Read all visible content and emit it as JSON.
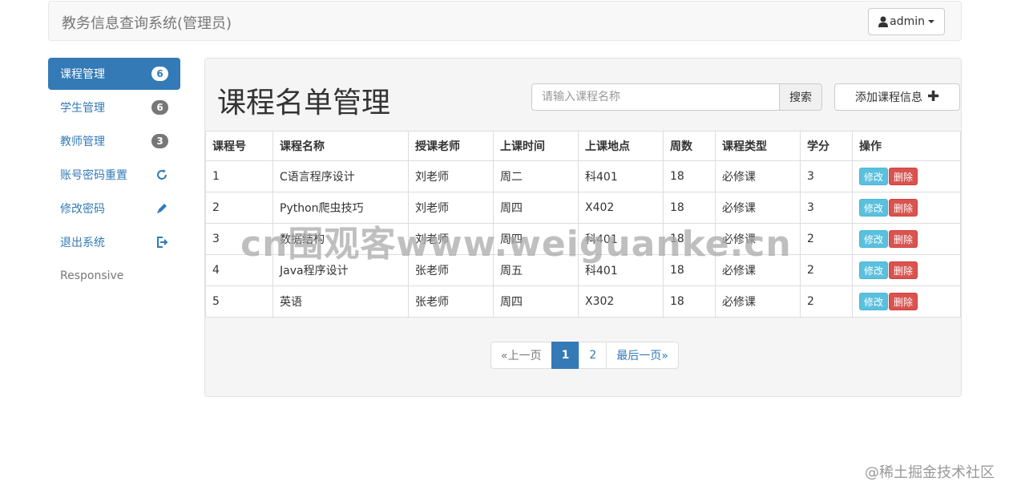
{
  "header": {
    "brand": "教务信息查询系统(管理员)",
    "user": "admin"
  },
  "sidebar": {
    "items": [
      {
        "label": "课程管理",
        "badge": "6"
      },
      {
        "label": "学生管理",
        "badge": "6"
      },
      {
        "label": "教师管理",
        "badge": "3"
      },
      {
        "label": "账号密码重置",
        "icon": "refresh-icon"
      },
      {
        "label": "修改密码",
        "icon": "pencil-icon"
      },
      {
        "label": "退出系统",
        "icon": "logout-icon"
      },
      {
        "label": "Responsive"
      }
    ]
  },
  "main": {
    "title": "课程名单管理",
    "search": {
      "placeholder": "请输入课程名称",
      "button": "搜索"
    },
    "add_button": "添加课程信息",
    "table": {
      "headers": [
        "课程号",
        "课程名称",
        "授课老师",
        "上课时间",
        "上课地点",
        "周数",
        "课程类型",
        "学分",
        "操作"
      ],
      "rows": [
        [
          "1",
          "C语言程序设计",
          "刘老师",
          "周二",
          "科401",
          "18",
          "必修课",
          "3"
        ],
        [
          "2",
          "Python爬虫技巧",
          "刘老师",
          "周四",
          "X402",
          "18",
          "必修课",
          "3"
        ],
        [
          "3",
          "数据结构",
          "刘老师",
          "周四",
          "科401",
          "18",
          "必修课",
          "2"
        ],
        [
          "4",
          "Java程序设计",
          "张老师",
          "周五",
          "科401",
          "18",
          "必修课",
          "2"
        ],
        [
          "5",
          "英语",
          "张老师",
          "周四",
          "X302",
          "18",
          "必修课",
          "2"
        ]
      ],
      "edit_label": "修改",
      "delete_label": "删除"
    },
    "pagination": {
      "prev": "«上一页",
      "pages": [
        "1",
        "2"
      ],
      "last": "最后一页»"
    }
  },
  "watermark": "cn围观客www.weiguanke.cn",
  "corner_watermark": "@稀土掘金技术社区",
  "colors": {
    "primary": "#337ab7",
    "info": "#5bc0de",
    "danger": "#d9534f"
  }
}
